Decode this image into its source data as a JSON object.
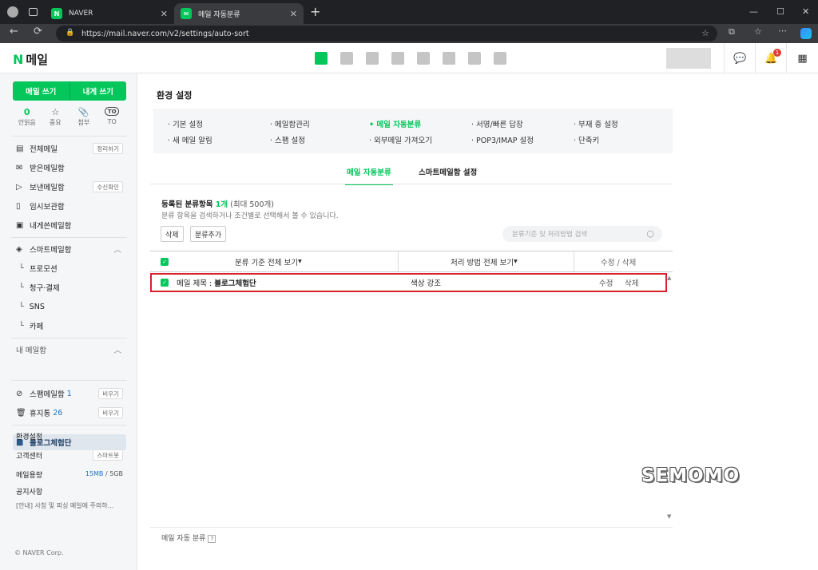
{
  "browser": {
    "tabs": [
      {
        "title": "NAVER",
        "favicon": "N",
        "close": "✕"
      },
      {
        "title": "메일 자동분류",
        "favicon": "✉",
        "close": "✕"
      }
    ],
    "new_tab": "+",
    "url": "https://mail.naver.com/v2/settings/auto-sort"
  },
  "app": {
    "logo_letter": "N",
    "logo_text": "메일",
    "avatar_color": "#dddddd",
    "notification_count": "1"
  },
  "sidebar": {
    "write_button": "메일 쓰기",
    "self_write_button": "내게 쓰기",
    "quick": [
      {
        "icon": "0",
        "label": "안읽음"
      },
      {
        "icon": "☆",
        "label": "중요"
      },
      {
        "icon": "📎",
        "label": "첨부"
      },
      {
        "icon": "TO",
        "label": "TO"
      }
    ],
    "items": [
      {
        "label": "전체메일",
        "action": "정리하기"
      },
      {
        "label": "받은메일함"
      },
      {
        "label": "보낸메일함",
        "action": "수신확인"
      },
      {
        "label": "임시보관함"
      },
      {
        "label": "내게쓴메일함"
      }
    ],
    "smart": {
      "label": "스마트메일함",
      "children": [
        "프로모션",
        "청구·결제",
        "SNS",
        "카페"
      ]
    },
    "my_mailbox": {
      "label": "내 메일함",
      "selected": "블로그체험단"
    },
    "spam": {
      "label": "스팸메일함",
      "count": "1",
      "action": "비우기"
    },
    "trash": {
      "label": "휴지통",
      "count": "26",
      "action": "비우기"
    },
    "settings": "환경설정",
    "support": {
      "label": "고객센터",
      "action": "스마트봇"
    },
    "capacity": {
      "label": "메일용량",
      "used": "15MB",
      "separator": "/",
      "total": "5GB"
    },
    "notice": {
      "label": "공지사항",
      "text": "[안내] 사칭 및 피싱 메일에 주의하..."
    },
    "copyright": "© NAVER Corp."
  },
  "main": {
    "title": "환경 설정",
    "settings_menu": [
      "기본 설정",
      "메일함관리",
      "메일 자동분류",
      "서명/빠른 답장",
      "부재 중 설정",
      "새 메일 알림",
      "스팸 설정",
      "외부메일 가져오기",
      "POP3/IMAP 설정",
      "단축키"
    ],
    "active_setting": "메일 자동분류",
    "subtabs": [
      "메일 자동분류",
      "스마트메일함 설정"
    ],
    "summary": {
      "prefix": "등록된 분류항목 ",
      "count": "1개",
      "max": " (최대 500개)"
    },
    "description": "분류 항목을 검색하거나 조건별로 선택해서 볼 수 있습니다.",
    "delete_button": "삭제",
    "add_button": "분류추가",
    "search_placeholder": "분류기준 및 처리방법 검색",
    "table": {
      "headers": [
        "분류 기준 전체 보기",
        "처리 방법 전체 보기",
        "수정 / 삭제"
      ],
      "rows": [
        {
          "criteria_label": "메일 제목 : ",
          "criteria_value": "블로그체험단",
          "action": "색상 강조",
          "edit": "수정",
          "delete": "삭제"
        }
      ]
    },
    "footer_help": "메일 자동 분류",
    "watermark": "SEMOMO"
  }
}
